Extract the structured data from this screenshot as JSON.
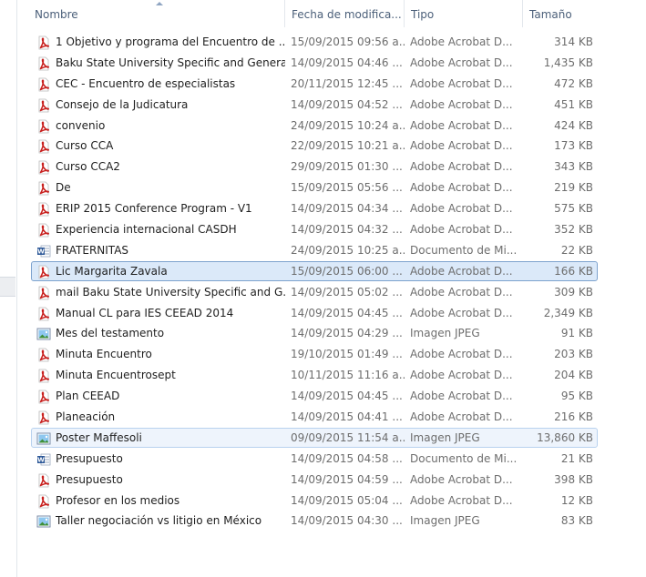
{
  "columns": {
    "name": "Nombre",
    "date": "Fecha de modifica...",
    "type": "Tipo",
    "size": "Tamaño"
  },
  "files": [
    {
      "name": "1 Objetivo y programa del Encuentro de ...",
      "date": "15/09/2015 09:56 a...",
      "type": "Adobe Acrobat D...",
      "size": "314 KB",
      "icon": "pdf-icon",
      "state": ""
    },
    {
      "name": "Baku State University Specific and Genera...",
      "date": "14/09/2015 04:46 ...",
      "type": "Adobe Acrobat D...",
      "size": "1,435 KB",
      "icon": "pdf-icon",
      "state": ""
    },
    {
      "name": "CEC - Encuentro de especialistas",
      "date": "20/11/2015 12:45 ...",
      "type": "Adobe Acrobat D...",
      "size": "472 KB",
      "icon": "pdf-icon",
      "state": ""
    },
    {
      "name": "Consejo de la Judicatura",
      "date": "14/09/2015 04:52 ...",
      "type": "Adobe Acrobat D...",
      "size": "451 KB",
      "icon": "pdf-icon",
      "state": ""
    },
    {
      "name": "convenio",
      "date": "24/09/2015 10:24 a...",
      "type": "Adobe Acrobat D...",
      "size": "424 KB",
      "icon": "pdf-icon",
      "state": ""
    },
    {
      "name": "Curso CCA",
      "date": "22/09/2015 10:21 a...",
      "type": "Adobe Acrobat D...",
      "size": "173 KB",
      "icon": "pdf-icon",
      "state": ""
    },
    {
      "name": "Curso CCA2",
      "date": "29/09/2015 01:30 ...",
      "type": "Adobe Acrobat D...",
      "size": "343 KB",
      "icon": "pdf-icon",
      "state": ""
    },
    {
      "name": "De",
      "date": "15/09/2015 05:56 ...",
      "type": "Adobe Acrobat D...",
      "size": "219 KB",
      "icon": "pdf-icon",
      "state": ""
    },
    {
      "name": "ERIP 2015 Conference Program - V1",
      "date": "14/09/2015 04:34 ...",
      "type": "Adobe Acrobat D...",
      "size": "575 KB",
      "icon": "pdf-icon",
      "state": ""
    },
    {
      "name": "Experiencia internacional CASDH",
      "date": "14/09/2015 04:32 ...",
      "type": "Adobe Acrobat D...",
      "size": "352 KB",
      "icon": "pdf-icon",
      "state": ""
    },
    {
      "name": "FRATERNITAS",
      "date": "24/09/2015 10:25 a...",
      "type": "Documento de Mi...",
      "size": "22 KB",
      "icon": "word-doc-icon",
      "state": ""
    },
    {
      "name": "Lic  Margarita Zavala",
      "date": "15/09/2015 06:00 ...",
      "type": "Adobe Acrobat D...",
      "size": "166 KB",
      "icon": "pdf-icon",
      "state": "selected"
    },
    {
      "name": "mail Baku State University Specific and G...",
      "date": "14/09/2015 05:02 ...",
      "type": "Adobe Acrobat D...",
      "size": "309 KB",
      "icon": "pdf-icon",
      "state": ""
    },
    {
      "name": "Manual CL para IES CEEAD 2014",
      "date": "14/09/2015 04:45 ...",
      "type": "Adobe Acrobat D...",
      "size": "2,349 KB",
      "icon": "pdf-icon",
      "state": ""
    },
    {
      "name": "Mes del testamento",
      "date": "14/09/2015 04:29 ...",
      "type": "Imagen JPEG",
      "size": "91 KB",
      "icon": "jpeg-image-icon",
      "state": ""
    },
    {
      "name": "Minuta Encuentro",
      "date": "19/10/2015 01:49 ...",
      "type": "Adobe Acrobat D...",
      "size": "203 KB",
      "icon": "pdf-icon",
      "state": ""
    },
    {
      "name": "Minuta Encuentrosept",
      "date": "10/11/2015 11:16 a...",
      "type": "Adobe Acrobat D...",
      "size": "204 KB",
      "icon": "pdf-icon",
      "state": ""
    },
    {
      "name": "Plan CEEAD",
      "date": "14/09/2015 04:45 ...",
      "type": "Adobe Acrobat D...",
      "size": "95 KB",
      "icon": "pdf-icon",
      "state": ""
    },
    {
      "name": "Planeación",
      "date": "14/09/2015 04:41 ...",
      "type": "Adobe Acrobat D...",
      "size": "216 KB",
      "icon": "pdf-icon",
      "state": ""
    },
    {
      "name": "Poster Maffesoli",
      "date": "09/09/2015 11:54 a...",
      "type": "Imagen JPEG",
      "size": "13,860 KB",
      "icon": "jpeg-image-icon",
      "state": "hover"
    },
    {
      "name": "Presupuesto",
      "date": "14/09/2015 04:58 ...",
      "type": "Documento de Mi...",
      "size": "21 KB",
      "icon": "word-doc-icon",
      "state": ""
    },
    {
      "name": "Presupuesto",
      "date": "14/09/2015 04:59 ...",
      "type": "Adobe Acrobat D...",
      "size": "398 KB",
      "icon": "pdf-icon",
      "state": ""
    },
    {
      "name": "Profesor en los medios",
      "date": "14/09/2015 05:04 ...",
      "type": "Adobe Acrobat D...",
      "size": "12 KB",
      "icon": "pdf-icon",
      "state": ""
    },
    {
      "name": "Taller negociación vs litigio en México",
      "date": "14/09/2015 04:30 ...",
      "type": "Imagen JPEG",
      "size": "83 KB",
      "icon": "jpeg-image-icon",
      "state": ""
    }
  ],
  "colors": {
    "selection_bg": "#dbe9f9",
    "selection_border": "#7da2ce",
    "pdf_red": "#c8201e",
    "word_blue": "#2b5797",
    "header_text": "#4c607a"
  }
}
